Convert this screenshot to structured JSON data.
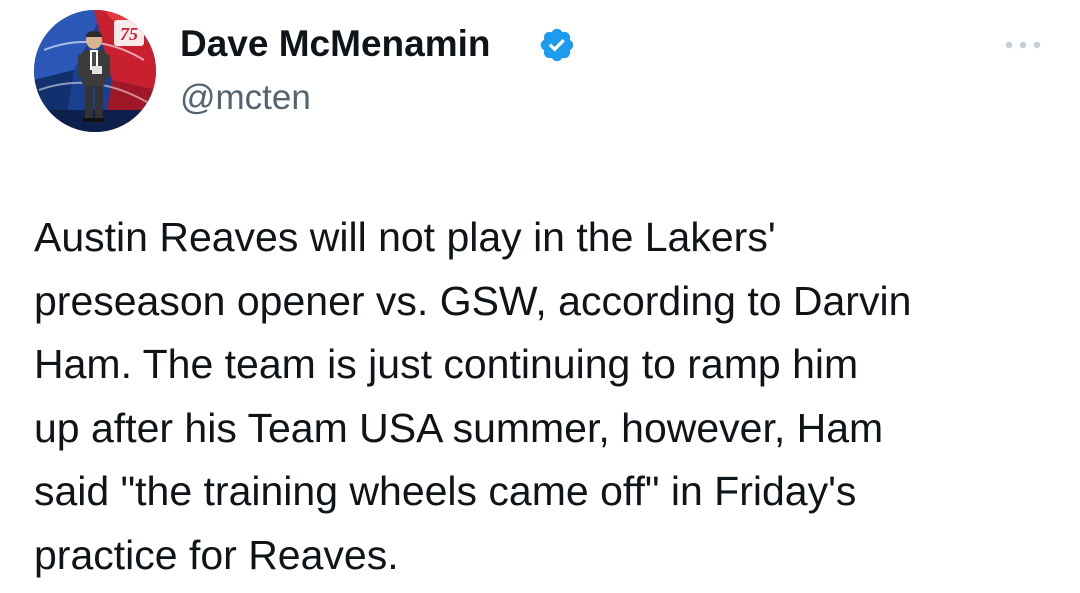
{
  "author": {
    "display_name": "Dave McMenamin",
    "handle": "@mcten",
    "verified": true,
    "verified_color": "#1d9bf0",
    "avatar_badge_text": "75"
  },
  "menu": {
    "icon": "more-horizontal-icon"
  },
  "tweet": {
    "lines": [
      "Austin Reaves will not play in the Lakers'",
      "preseason opener vs. GSW, according to Darvin",
      "Ham. The team is just continuing to ramp him",
      "up after his Team USA summer, however, Ham",
      "said \"the training wheels came off\" in Friday's",
      "practice for Reaves."
    ]
  },
  "colors": {
    "text_primary": "#0f1419",
    "text_secondary": "#536471",
    "background": "#ffffff"
  }
}
